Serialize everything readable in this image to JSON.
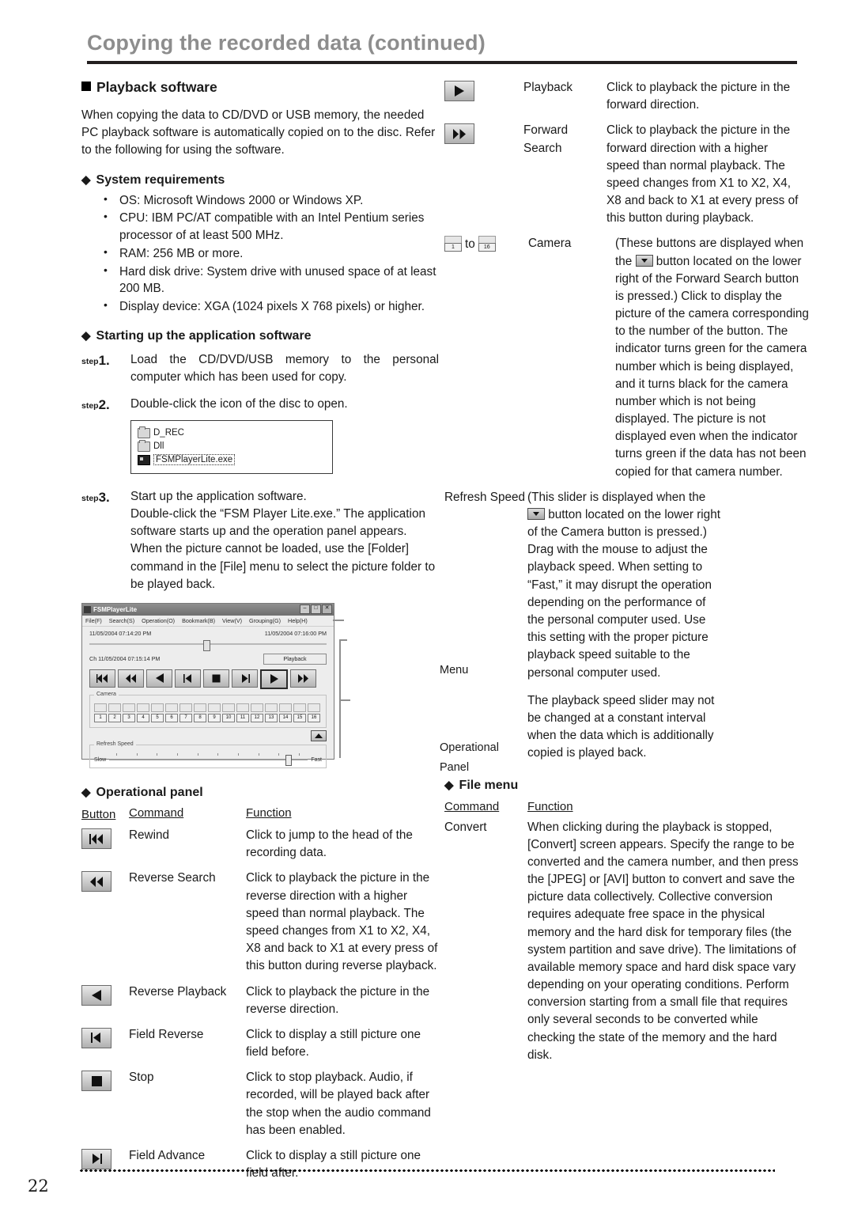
{
  "header": {
    "title": "Copying the recorded data (continued)"
  },
  "left": {
    "section_playback_software": "Playback software",
    "intro": "When copying the data to CD/DVD or USB memory, the needed PC playback software is automatically copied on to the disc. Refer to the following for using the software.",
    "system_requirements": {
      "heading": "System requirements",
      "items": [
        "OS: Microsoft Windows 2000 or Windows XP.",
        "CPU: IBM PC/AT compatible with an Intel Pentium series processor of at least 500 MHz.",
        "RAM: 256 MB or more.",
        "Hard disk drive: System drive with unused space of at least 200 MB.",
        "Display device: XGA (1024 pixels X 768 pixels) or higher."
      ]
    },
    "starting_up": {
      "heading": "Starting up the application software",
      "step_word": "step",
      "steps": [
        {
          "n": "1.",
          "text": "Load the CD/DVD/USB memory to the personal computer which has been used for copy."
        },
        {
          "n": "2.",
          "text": "Double-click the icon of the disc to open."
        },
        {
          "n": "3.",
          "text": "Start up the application software.\nDouble-click the “FSM Player Lite.exe.”  The application software starts up and the operation panel appears.\nWhen the picture cannot be loaded, use the [Folder] command in the [File] menu to select the picture folder to be played back."
        }
      ]
    },
    "disc_contents": [
      {
        "name": "D_REC",
        "icon": "folder-icon",
        "selected": false
      },
      {
        "name": "Dll",
        "icon": "folder-icon",
        "selected": false
      },
      {
        "name": "FSMPlayerLite.exe",
        "icon": "executable-icon",
        "selected": true
      }
    ],
    "operational_panel": {
      "heading": "Operational panel",
      "columns": [
        "Button",
        "Command",
        "Function"
      ],
      "rows": [
        {
          "icon": "rewind-icon",
          "command": "Rewind",
          "function": "Click to jump to the head of the recording data."
        },
        {
          "icon": "reverse-search-icon",
          "command": "Reverse Search",
          "function": "Click to playback the picture in the reverse direction with a higher speed than normal playback. The speed changes from X1 to X2, X4, X8 and back to X1 at every press of this button during reverse playback."
        },
        {
          "icon": "reverse-playback-icon",
          "command": "Reverse Playback",
          "function": "Click to playback the picture in the reverse direction."
        },
        {
          "icon": "field-reverse-icon",
          "command": "Field Reverse",
          "function": "Click to display a still picture one field before."
        },
        {
          "icon": "stop-icon",
          "command": "Stop",
          "function": "Click to stop playback. Audio, if recorded, will be played back after the stop when the audio command has been enabled."
        },
        {
          "icon": "field-advance-icon",
          "command": "Field Advance",
          "function": "Click to display a still picture one field after."
        }
      ]
    }
  },
  "right": {
    "panel_rows": [
      {
        "icon": "playback-icon",
        "command": "Playback",
        "function": "Click to playback the picture in the forward direction."
      },
      {
        "icon": "forward-search-icon",
        "command": "Forward Search",
        "function": "Click to playback the picture in the forward direction with a higher speed than normal playback. The speed changes from X1 to X2, X4, X8 and back to X1 at every press of this button during playback."
      },
      {
        "icon": "camera-range-icon",
        "command": "Camera",
        "range_from": "1",
        "range_to": "16",
        "range_word": "to",
        "function_part1": "(These buttons are displayed when the ",
        "function_part2": " button located on the lower right of the Forward Search button is pressed.) Click to display the picture of the camera corresponding to the number of the button. The indicator turns green for the camera number which is being displayed, and it turns black for the camera number which is not being displayed. The picture is not displayed even when the indicator turns green if the data has not been copied for that camera number."
      },
      {
        "icon": "refresh-speed-slider",
        "command": "Refresh Speed",
        "function_part1": "(This slider is displayed when the ",
        "function_part2": " button located on the lower right of the Camera button is pressed.) Drag with the mouse to adjust the playback speed. When setting to “Fast,” it may disrupt the operation depending on the performance of the personal computer used. Use this setting with the proper picture playback speed suitable to the personal computer used.",
        "function_note": "The playback speed slider may not be changed at a constant interval when the data which is additionally copied is played back."
      }
    ],
    "file_menu": {
      "heading": "File menu",
      "columns": [
        "Command",
        "Function"
      ],
      "rows": [
        {
          "command": "Convert",
          "function": "When clicking during the playback is stopped, [Convert] screen appears. Specify the range to be converted and the camera number, and then press the [JPEG] or [AVI] button to convert and save the picture data collectively. Collective conversion requires adequate free space in the physical memory and the hard disk for temporary files (the system partition and save drive). The limitations of available memory space and hard disk space vary depending on your operating conditions. Perform conversion starting from a small file that requires only several seconds to be converted while checking the state of the memory and the hard disk."
        }
      ]
    }
  },
  "player_screenshot": {
    "window_title": "FSMPlayerLite",
    "window_buttons": [
      "–",
      "□",
      "✕"
    ],
    "menu_items": [
      "File(F)",
      "Search(S)",
      "Operation(O)",
      "Bookmark(B)",
      "View(V)",
      "Grouping(G)",
      "Help(H)"
    ],
    "time_start": "11/05/2004 07:14:20 PM",
    "time_end": "11/05/2004 07:16:00 PM",
    "channel_time": "Ch  11/05/2004 07:15:14 PM",
    "playback_label": "Playback",
    "transport_icons": [
      "rewind-icon",
      "reverse-search-icon",
      "reverse-playback-icon",
      "field-reverse-icon",
      "stop-icon",
      "field-advance-icon",
      "playback-icon",
      "forward-search-icon"
    ],
    "camera_group_label": "Camera",
    "camera_numbers": [
      "1",
      "2",
      "3",
      "4",
      "5",
      "6",
      "7",
      "8",
      "9",
      "10",
      "11",
      "12",
      "13",
      "14",
      "15",
      "16"
    ],
    "refresh_group_label": "Refresh Speed",
    "slow_label": "Slow",
    "fast_label": "Fast",
    "callouts": {
      "menu": "Menu",
      "operational_panel": "Operational\nPanel"
    }
  },
  "footer": {
    "page_number": "22"
  }
}
